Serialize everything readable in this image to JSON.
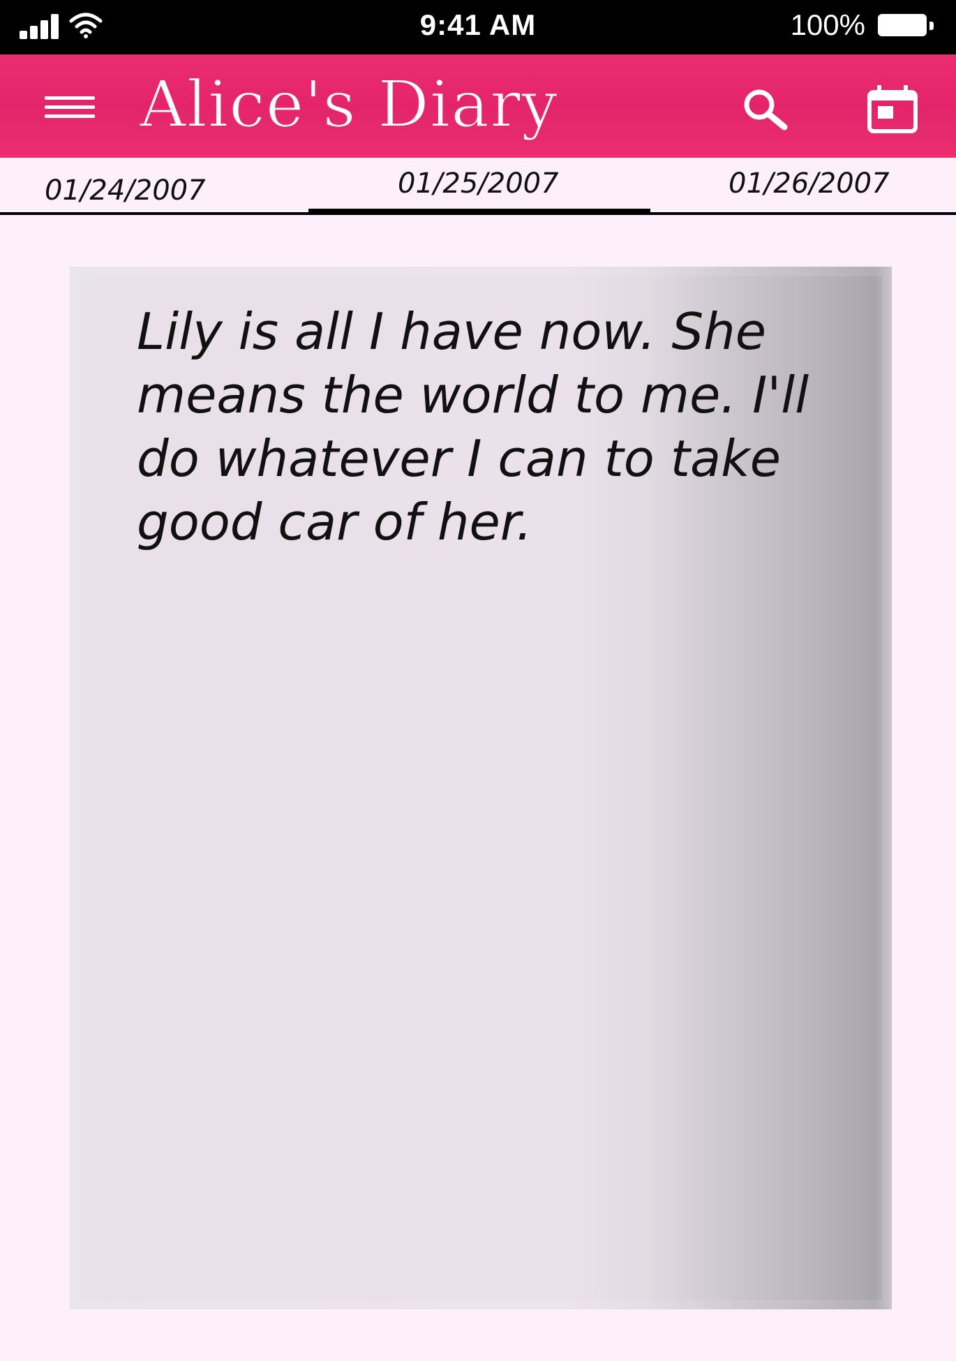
{
  "status_bar": {
    "time": "9:41 AM",
    "battery_percent": "100%",
    "signal_icon": "cellular-signal-icon",
    "wifi_icon": "wifi-icon",
    "battery_icon": "battery-icon",
    "battery_level": 1.0
  },
  "app_bar": {
    "title": "Alice's Diary",
    "menu_icon": "hamburger-menu-icon",
    "search_icon": "search-icon",
    "calendar_icon": "calendar-icon",
    "color": "#e6286b"
  },
  "tabs": [
    {
      "label": "01/24/2007",
      "selected": false
    },
    {
      "label": "01/25/2007",
      "selected": true
    },
    {
      "label": "01/26/2007",
      "selected": false
    }
  ],
  "entry": {
    "text": "Lily is all I have now. She\nmeans the world to me. I'll\ndo whatever I can to take\ngood car of her."
  }
}
